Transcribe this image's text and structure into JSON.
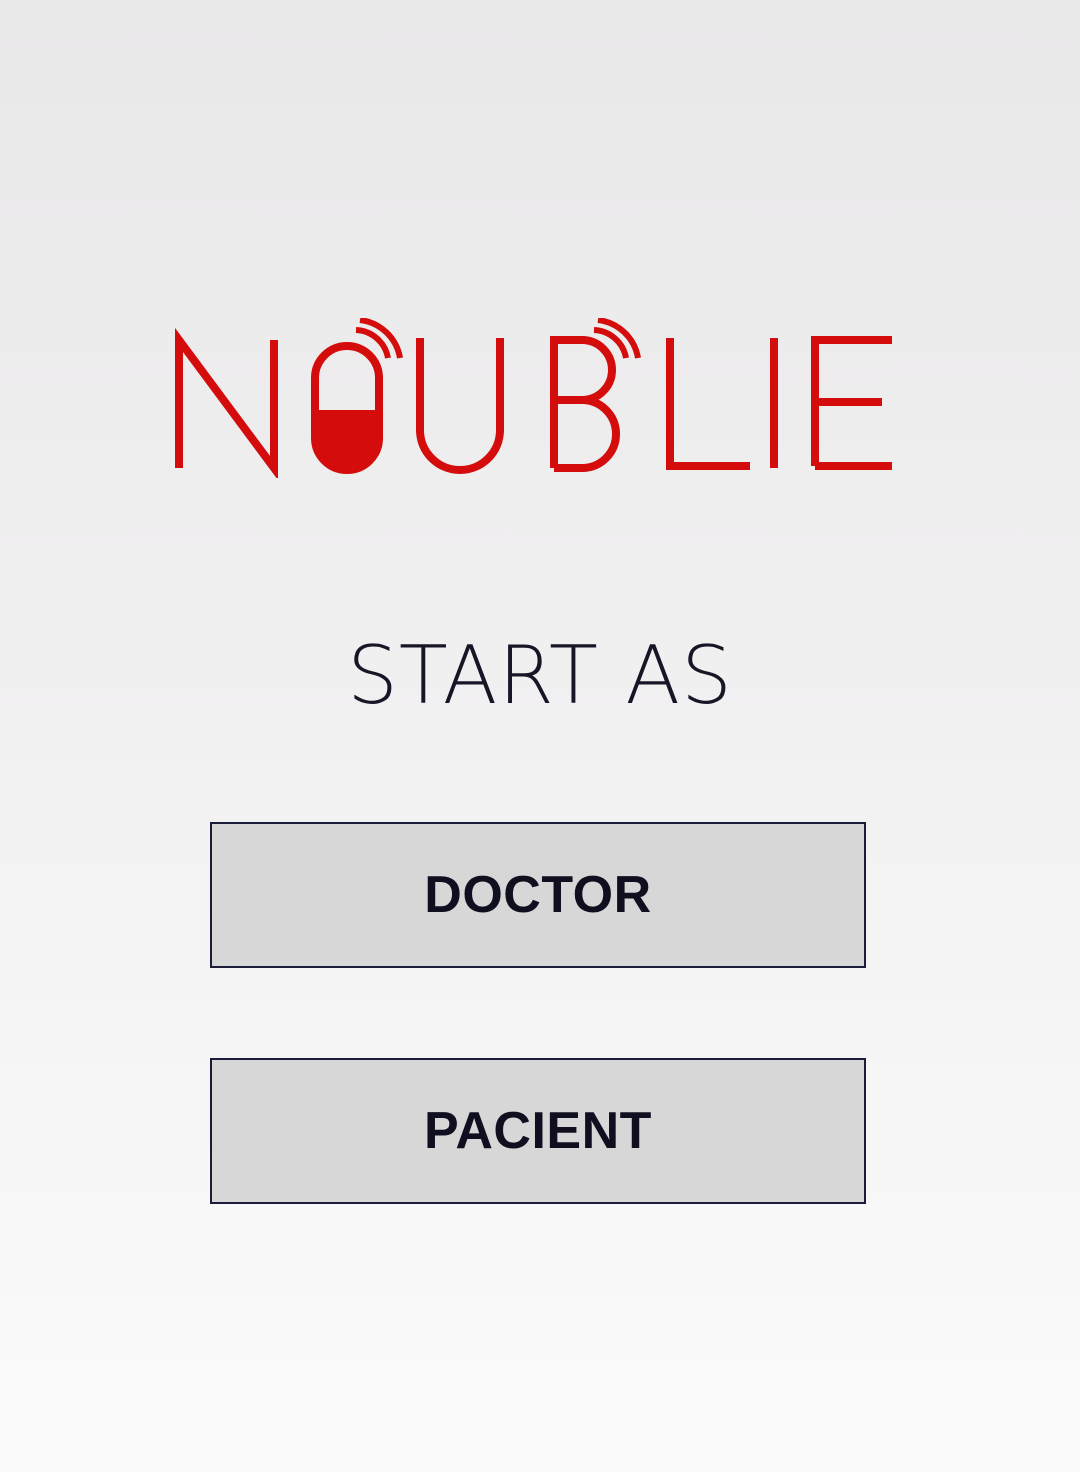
{
  "logo": {
    "text": "NOUBLIE",
    "brand_color": "#d40c0c"
  },
  "heading": "START AS",
  "buttons": {
    "doctor_label": "DOCTOR",
    "pacient_label": "PACIENT"
  },
  "colors": {
    "button_background": "#d7d7d7",
    "button_border": "#1b1b3a",
    "text": "#161627"
  }
}
